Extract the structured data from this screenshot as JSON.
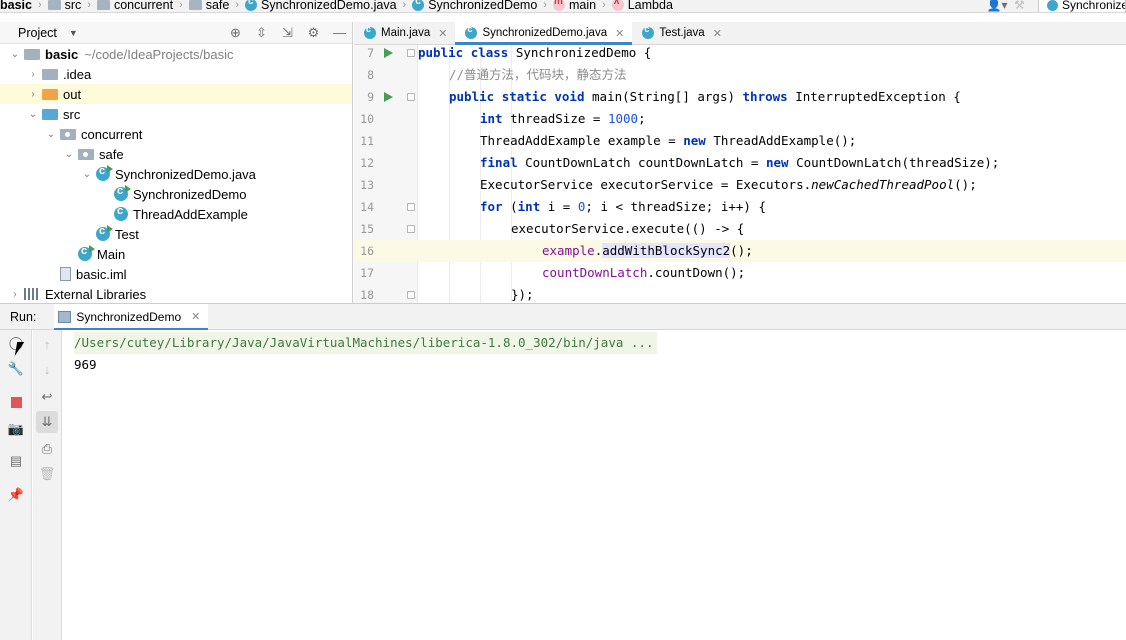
{
  "navbar": {
    "crumbs": [
      {
        "label": "basic",
        "icon": "none",
        "bold": true
      },
      {
        "label": "src",
        "icon": "folder-icon"
      },
      {
        "label": "concurrent",
        "icon": "folder-icon"
      },
      {
        "label": "safe",
        "icon": "folder-icon"
      },
      {
        "label": "SynchronizedDemo.java",
        "icon": "class-icon"
      },
      {
        "label": "SynchronizedDemo",
        "icon": "class-icon"
      },
      {
        "label": "main",
        "icon": "method-icon"
      },
      {
        "label": "Lambda",
        "icon": "lambda-icon"
      }
    ],
    "run_config": "SynchronizedDemo"
  },
  "project": {
    "title": "Project",
    "tree": [
      {
        "label": "basic",
        "hint": "~/code/IdeaProjects/basic",
        "depth": 0,
        "arrow": "open",
        "icon": "module",
        "bold": true
      },
      {
        "label": ".idea",
        "depth": 1,
        "arrow": "closed",
        "icon": "folder"
      },
      {
        "label": "out",
        "depth": 1,
        "arrow": "closed",
        "icon": "folder-excluded",
        "selected": true
      },
      {
        "label": "src",
        "depth": 1,
        "arrow": "open",
        "icon": "source-folder"
      },
      {
        "label": "concurrent",
        "depth": 2,
        "arrow": "open",
        "icon": "package"
      },
      {
        "label": "safe",
        "depth": 3,
        "arrow": "open",
        "icon": "package"
      },
      {
        "label": "SynchronizedDemo.java",
        "depth": 4,
        "arrow": "open",
        "icon": "class-run"
      },
      {
        "label": "SynchronizedDemo",
        "depth": 5,
        "arrow": "none",
        "icon": "class-run"
      },
      {
        "label": "ThreadAddExample",
        "depth": 5,
        "arrow": "none",
        "icon": "class"
      },
      {
        "label": "Test",
        "depth": 4,
        "arrow": "none",
        "icon": "class-run"
      },
      {
        "label": "Main",
        "depth": 3,
        "arrow": "none",
        "icon": "class-run"
      },
      {
        "label": "basic.iml",
        "depth": 2,
        "arrow": "none",
        "icon": "iml"
      },
      {
        "label": "External Libraries",
        "depth": 0,
        "arrow": "closed",
        "icon": "library"
      }
    ]
  },
  "editor_tabs": [
    {
      "label": "Main.java",
      "active": false
    },
    {
      "label": "SynchronizedDemo.java",
      "active": true
    },
    {
      "label": "Test.java",
      "active": false
    }
  ],
  "code": [
    {
      "ln": "7",
      "run": true,
      "fold": true,
      "indent": 0,
      "tokens": [
        [
          "kw",
          "public "
        ],
        [
          "kw",
          "class "
        ],
        [
          "t",
          "SynchronizedDemo {"
        ]
      ]
    },
    {
      "ln": "8",
      "indent": 1,
      "tokens": [
        [
          "cm",
          "//普通方法，代码块，静态方法"
        ]
      ]
    },
    {
      "ln": "9",
      "run": true,
      "fold": true,
      "indent": 1,
      "tokens": [
        [
          "kw",
          "public "
        ],
        [
          "kw",
          "static "
        ],
        [
          "kw",
          "void "
        ],
        [
          "t",
          "main(String[] args) "
        ],
        [
          "kw",
          "throws "
        ],
        [
          "t",
          "InterruptedException {"
        ]
      ]
    },
    {
      "ln": "10",
      "indent": 2,
      "tokens": [
        [
          "kw",
          "int "
        ],
        [
          "t",
          "threadSize = "
        ],
        [
          "num",
          "1000"
        ],
        [
          "t",
          ";"
        ]
      ]
    },
    {
      "ln": "11",
      "indent": 2,
      "tokens": [
        [
          "t",
          "ThreadAddExample example = "
        ],
        [
          "kw",
          "new "
        ],
        [
          "t",
          "ThreadAddExample();"
        ]
      ]
    },
    {
      "ln": "12",
      "indent": 2,
      "tokens": [
        [
          "kw",
          "final "
        ],
        [
          "t",
          "CountDownLatch countDownLatch = "
        ],
        [
          "kw",
          "new "
        ],
        [
          "t",
          "CountDownLatch(threadSize);"
        ]
      ]
    },
    {
      "ln": "13",
      "indent": 2,
      "tokens": [
        [
          "t",
          "ExecutorService executorService = Executors."
        ],
        [
          "it",
          "newCachedThreadPool"
        ],
        [
          "t",
          "();"
        ]
      ]
    },
    {
      "ln": "14",
      "fold": true,
      "indent": 2,
      "tokens": [
        [
          "kw",
          "for "
        ],
        [
          "t",
          "("
        ],
        [
          "kw",
          "int "
        ],
        [
          "t",
          "i = "
        ],
        [
          "num",
          "0"
        ],
        [
          "t",
          "; i < threadSize; i++) {"
        ]
      ]
    },
    {
      "ln": "15",
      "fold": true,
      "indent": 3,
      "tokens": [
        [
          "t",
          "executorService.execute(() -> {"
        ]
      ]
    },
    {
      "ln": "16",
      "highlight": true,
      "indent": 4,
      "tokens": [
        [
          "fld",
          "example"
        ],
        [
          "t",
          "."
        ],
        [
          "sel",
          "addWithBlockSync2"
        ],
        [
          "t",
          "();"
        ]
      ]
    },
    {
      "ln": "17",
      "indent": 4,
      "tokens": [
        [
          "fld",
          "countDownLatch"
        ],
        [
          "t",
          ".countDown();"
        ]
      ]
    },
    {
      "ln": "18",
      "fold": true,
      "indent": 3,
      "tokens": [
        [
          "t",
          "});"
        ]
      ]
    }
  ],
  "run": {
    "label": "Run:",
    "tab": "SynchronizedDemo",
    "command": "/Users/cutey/Library/Java/JavaVirtualMachines/liberica-1.8.0_302/bin/java ...",
    "output": "969"
  },
  "colors": {
    "accent": "#4083c9",
    "run_green": "#499c54",
    "keyword": "#0033b3",
    "number": "#1750eb",
    "field": "#871094"
  }
}
